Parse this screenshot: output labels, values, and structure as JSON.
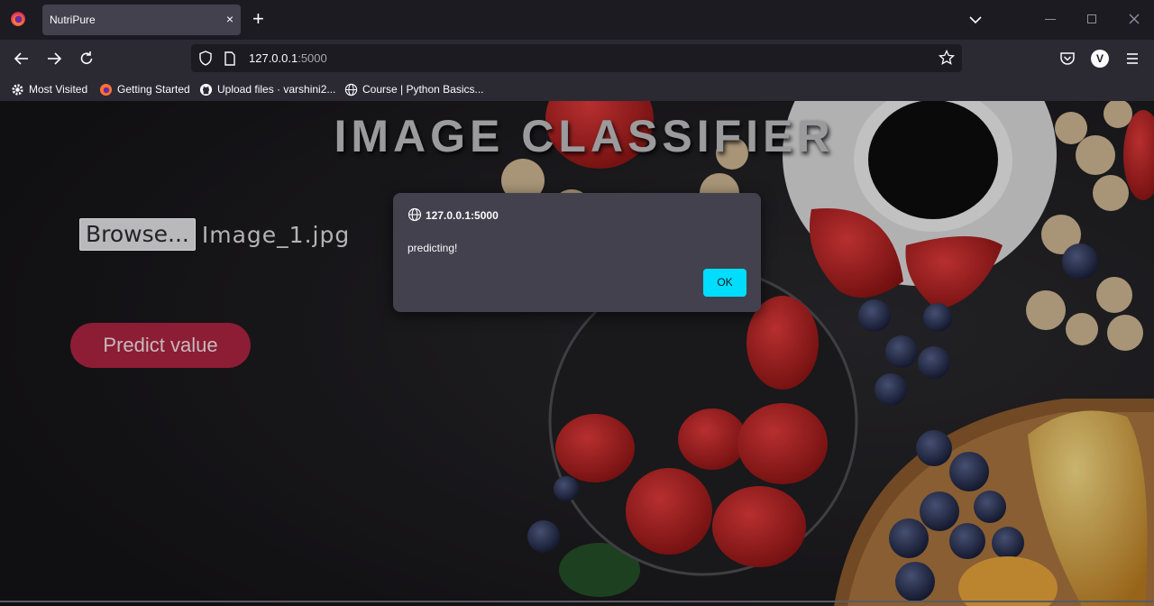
{
  "browser": {
    "tab_title": "NutriPure",
    "tab_close": "×",
    "new_tab": "+",
    "url_host": "127.0.0.1",
    "url_port": ":5000",
    "bookmarks": [
      {
        "label": "Most Visited",
        "icon": "gear-icon"
      },
      {
        "label": "Getting Started",
        "icon": "firefox-icon"
      },
      {
        "label": "Upload files · varshini2...",
        "icon": "github-icon"
      },
      {
        "label": "Course | Python Basics...",
        "icon": "globe-icon"
      }
    ],
    "account_initial": "V"
  },
  "page": {
    "title": "IMAGE CLASSIFIER",
    "browse_label": "Browse...",
    "file_name": "Image_1.jpg",
    "predict_label": "Predict value"
  },
  "dialog": {
    "origin": "127.0.0.1:5000",
    "message": "predicting!",
    "ok_label": "OK"
  },
  "colors": {
    "predict_button": "#8c1d35",
    "ok_button": "#00ddff",
    "dialog_bg": "#42414d"
  }
}
